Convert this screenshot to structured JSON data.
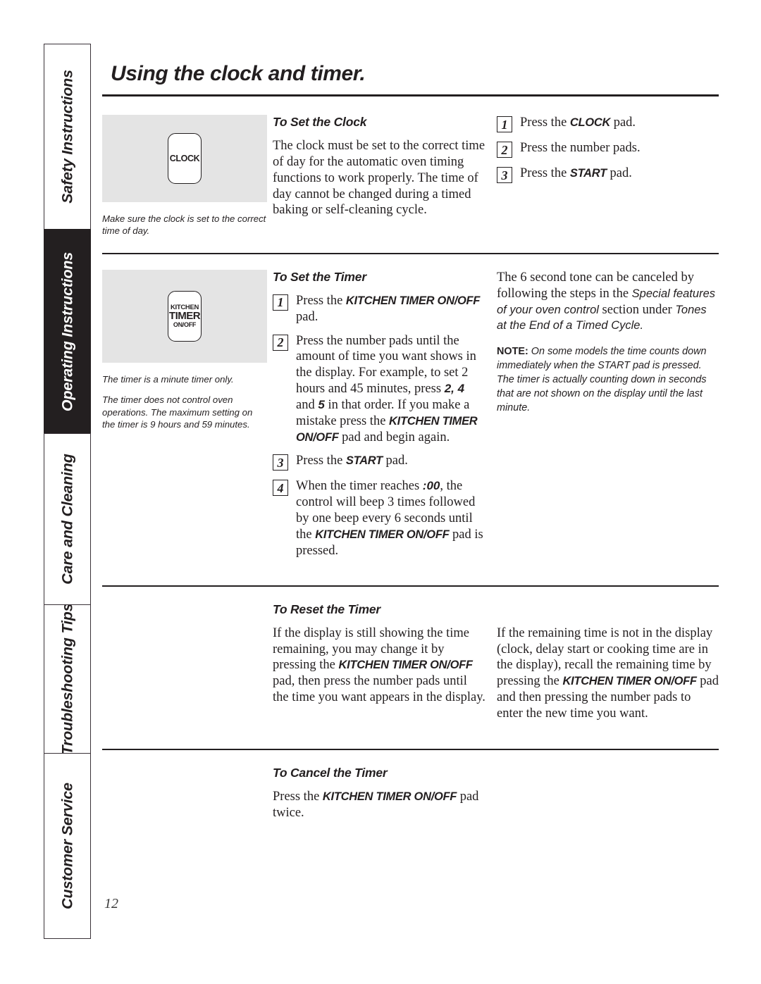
{
  "page": {
    "title": "Using the clock and timer.",
    "number": "12"
  },
  "sidebar": {
    "tabs": [
      {
        "label": "Safety Instructions",
        "active": false
      },
      {
        "label": "Operating Instructions",
        "active": true
      },
      {
        "label": "Care and Cleaning",
        "active": false
      },
      {
        "label": "Troubleshooting Tips",
        "active": false
      },
      {
        "label": "Customer Service",
        "active": false
      }
    ]
  },
  "sections": {
    "set_clock": {
      "heading": "To Set the Clock",
      "pad": {
        "lines": [
          "CLOCK"
        ]
      },
      "captions": [
        "Make sure the clock is set to the correct time of day."
      ],
      "body": "The clock must be set to the correct time of day for the automatic oven timing functions to work properly. The time of day cannot be changed during a timed baking or self-cleaning cycle.",
      "steps": [
        {
          "num": "1",
          "pre": "Press the ",
          "pad": "CLOCK",
          "post": " pad."
        },
        {
          "num": "2",
          "pre": "Press the number pads.",
          "pad": "",
          "post": ""
        },
        {
          "num": "3",
          "pre": "Press the ",
          "pad": "START",
          "post": " pad."
        }
      ]
    },
    "set_timer": {
      "heading": "To Set the Timer",
      "pad": {
        "lines": [
          "KITCHEN",
          "TIMER",
          "ON/OFF"
        ]
      },
      "captions": [
        "The timer is a minute timer only.",
        "The timer does not control oven operations. The maximum setting on the timer is 9 hours and 59 minutes."
      ],
      "steps": [
        {
          "num": "1",
          "parts": [
            {
              "t": "Press the ",
              "s": "serif"
            },
            {
              "t": "KITCHEN TIMER ON/OFF",
              "s": "pad"
            },
            {
              "t": " pad.",
              "s": "serif"
            }
          ]
        },
        {
          "num": "2",
          "parts": [
            {
              "t": "Press the number pads until the amount of time you want shows in the display. For example, to set 2 hours and 45 minutes, press ",
              "s": "serif"
            },
            {
              "t": "2, 4",
              "s": "num"
            },
            {
              "t": " and ",
              "s": "serif"
            },
            {
              "t": "5",
              "s": "num"
            },
            {
              "t": " in that order. If you make a mistake press the ",
              "s": "serif"
            },
            {
              "t": "KITCHEN TIMER ON/OFF",
              "s": "pad"
            },
            {
              "t": " pad and begin again.",
              "s": "serif"
            }
          ]
        },
        {
          "num": "3",
          "parts": [
            {
              "t": "Press the ",
              "s": "serif"
            },
            {
              "t": "START",
              "s": "pad"
            },
            {
              "t": " pad.",
              "s": "serif"
            }
          ]
        },
        {
          "num": "4",
          "parts": [
            {
              "t": "When the timer reaches ",
              "s": "serif"
            },
            {
              "t": ":00",
              "s": "num"
            },
            {
              "t": ", the control will beep 3 times followed by one beep every 6 seconds until the ",
              "s": "serif"
            },
            {
              "t": "KITCHEN TIMER ON/OFF",
              "s": "pad"
            },
            {
              "t": " pad is pressed.",
              "s": "serif"
            }
          ]
        }
      ],
      "right_paragraph": {
        "parts": [
          {
            "t": "The 6 second tone can be canceled by following the steps in the ",
            "s": "serif"
          },
          {
            "t": "Special features of your oven control",
            "s": "sans-ital"
          },
          {
            "t": " section under ",
            "s": "serif"
          },
          {
            "t": "Tones at the End of a Timed Cycle.",
            "s": "sans-ital"
          }
        ]
      },
      "note": {
        "label": "NOTE:",
        "text": " On some models the time counts down immediately when the START pad is pressed. The timer is actually counting down in seconds that are not shown on the display until the last minute."
      }
    },
    "reset_timer": {
      "heading": "To Reset the Timer",
      "left": {
        "parts": [
          {
            "t": "If the display is still showing the time remaining, you may change it by pressing the ",
            "s": "serif"
          },
          {
            "t": "KITCHEN TIMER ON/OFF",
            "s": "pad"
          },
          {
            "t": " pad, then press the number pads until the time you want appears in the display.",
            "s": "serif"
          }
        ]
      },
      "right": {
        "parts": [
          {
            "t": "If the remaining time is not in the display (clock, delay start or cooking time are in the display), recall the remaining time by pressing the ",
            "s": "serif"
          },
          {
            "t": "KITCHEN TIMER ON/OFF",
            "s": "pad"
          },
          {
            "t": " pad and then pressing the number pads to enter the new time you want.",
            "s": "serif"
          }
        ]
      }
    },
    "cancel_timer": {
      "heading": "To Cancel the Timer",
      "body": {
        "parts": [
          {
            "t": "Press the ",
            "s": "serif"
          },
          {
            "t": "KITCHEN TIMER ON/OFF",
            "s": "pad"
          },
          {
            "t": " pad twice.",
            "s": "serif"
          }
        ]
      }
    }
  }
}
